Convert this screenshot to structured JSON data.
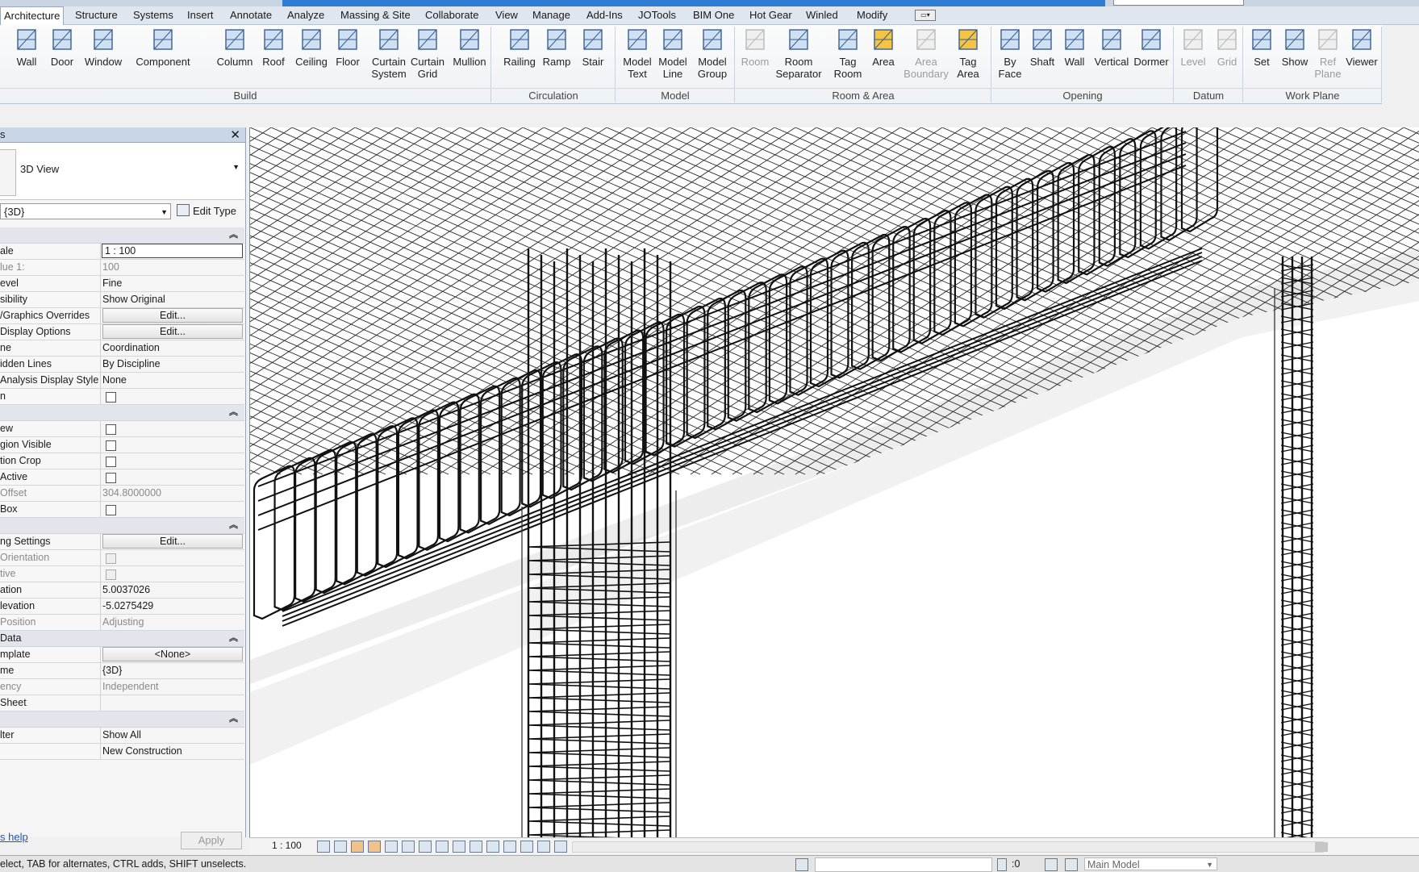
{
  "ribbon_tabs": [
    "Architecture",
    "Structure",
    "Systems",
    "Insert",
    "Annotate",
    "Analyze",
    "Massing & Site",
    "Collaborate",
    "View",
    "Manage",
    "Add-Ins",
    "JOTools",
    "BIM One",
    "Hot Gear",
    "Winled",
    "Modify"
  ],
  "ribbon": {
    "build": {
      "title": "Build",
      "buttons": [
        {
          "label": "Wall",
          "icon": "wall-icon"
        },
        {
          "label": "Door",
          "icon": "door-icon"
        },
        {
          "label": "Window",
          "icon": "window-icon"
        },
        {
          "label": "Component",
          "icon": "component-icon"
        },
        {
          "label": "Column",
          "icon": "column-icon"
        },
        {
          "label": "Roof",
          "icon": "roof-icon"
        },
        {
          "label": "Ceiling",
          "icon": "ceiling-icon"
        },
        {
          "label": "Floor",
          "icon": "floor-icon"
        },
        {
          "label": "Curtain",
          "label2": "System",
          "icon": "curtain-system-icon"
        },
        {
          "label": "Curtain",
          "label2": "Grid",
          "icon": "curtain-grid-icon"
        },
        {
          "label": "Mullion",
          "icon": "mullion-icon"
        }
      ]
    },
    "circulation": {
      "title": "Circulation",
      "buttons": [
        {
          "label": "Railing",
          "icon": "railing-icon"
        },
        {
          "label": "Ramp",
          "icon": "ramp-icon"
        },
        {
          "label": "Stair",
          "icon": "stair-icon"
        }
      ]
    },
    "model": {
      "title": "Model",
      "buttons": [
        {
          "label": "Model",
          "label2": "Text",
          "icon": "model-text-icon"
        },
        {
          "label": "Model",
          "label2": "Line",
          "icon": "model-line-icon"
        },
        {
          "label": "Model",
          "label2": "Group",
          "icon": "model-group-icon"
        }
      ]
    },
    "room_area": {
      "title": "Room & Area",
      "buttons": [
        {
          "label": "Room",
          "icon": "room-icon",
          "disabled": true
        },
        {
          "label": "Room",
          "label2": "Separator",
          "icon": "room-separator-icon"
        },
        {
          "label": "Tag",
          "label2": "Room",
          "icon": "tag-room-icon"
        },
        {
          "label": "Area",
          "icon": "area-icon"
        },
        {
          "label": "Area",
          "label2": "Boundary",
          "icon": "area-boundary-icon",
          "disabled": true
        },
        {
          "label": "Tag",
          "label2": "Area",
          "icon": "tag-area-icon"
        }
      ]
    },
    "opening": {
      "title": "Opening",
      "buttons": [
        {
          "label": "By",
          "label2": "Face",
          "icon": "by-face-icon"
        },
        {
          "label": "Shaft",
          "icon": "shaft-icon"
        },
        {
          "label": "Wall",
          "icon": "wall-opening-icon"
        },
        {
          "label": "Vertical",
          "icon": "vertical-icon"
        },
        {
          "label": "Dormer",
          "icon": "dormer-icon"
        }
      ]
    },
    "datum": {
      "title": "Datum",
      "buttons": [
        {
          "label": "Level",
          "icon": "level-icon",
          "disabled": true
        },
        {
          "label": "Grid",
          "icon": "grid-icon",
          "disabled": true
        }
      ]
    },
    "work_plane": {
      "title": "Work Plane",
      "buttons": [
        {
          "label": "Set",
          "icon": "set-icon"
        },
        {
          "label": "Show",
          "icon": "show-icon"
        },
        {
          "label": "Ref",
          "label2": "Plane",
          "icon": "ref-plane-icon",
          "disabled": true
        },
        {
          "label": "Viewer",
          "icon": "viewer-icon"
        }
      ]
    }
  },
  "properties": {
    "header": "s",
    "type_name": "3D View",
    "view_selector": "{3D}",
    "edit_type": "Edit Type",
    "rows": [
      {
        "kind": "section"
      },
      {
        "k": "ale",
        "v": "1 : 100",
        "style": "input"
      },
      {
        "k": "lue   1:",
        "v": "100",
        "gray": true
      },
      {
        "k": "evel",
        "v": "Fine"
      },
      {
        "k": "sibility",
        "v": "Show Original"
      },
      {
        "k": "/Graphics Overrides",
        "v": "Edit...",
        "style": "btn"
      },
      {
        "k": " Display Options",
        "v": "Edit...",
        "style": "btn"
      },
      {
        "k": "ne",
        "v": "Coordination"
      },
      {
        "k": "idden Lines",
        "v": "By Discipline"
      },
      {
        "k": "Analysis Display Style",
        "v": "None"
      },
      {
        "k": "n",
        "check": true
      },
      {
        "kind": "section"
      },
      {
        "k": "ew",
        "check": true
      },
      {
        "k": "gion Visible",
        "check": true
      },
      {
        "k": "tion Crop",
        "check": true
      },
      {
        "k": " Active",
        "check": true
      },
      {
        "k": " Offset",
        "v": "304.8000000",
        "gray": true
      },
      {
        "k": " Box",
        "check": true
      },
      {
        "kind": "section"
      },
      {
        "k": "ng Settings",
        "v": "Edit...",
        "style": "btn"
      },
      {
        "k": " Orientation",
        "check": true,
        "gray": true
      },
      {
        "k": "tive",
        "check": true,
        "gray": true
      },
      {
        "k": "ation",
        "v": "5.0037026"
      },
      {
        "k": "levation",
        "v": "-5.0275429"
      },
      {
        "k": " Position",
        "v": "Adjusting",
        "gray": true
      },
      {
        "kind": "section",
        "label": "Data"
      },
      {
        "k": "mplate",
        "v": "<None>",
        "style": "btn"
      },
      {
        "k": "me",
        "v": "{3D}"
      },
      {
        "k": "ency",
        "v": "Independent",
        "gray": true
      },
      {
        "k": " Sheet",
        "v": ""
      },
      {
        "kind": "section"
      },
      {
        "k": "lter",
        "v": "Show All"
      },
      {
        "k": "",
        "v": "New Construction"
      }
    ],
    "help_link": "s help",
    "apply": "Apply"
  },
  "view_control": {
    "scale": "1 : 100"
  },
  "status": {
    "message": "elect, TAB for alternates, CTRL adds, SHIFT unselects.",
    "selection_count": ":0",
    "model": "Main Model"
  },
  "colors": {
    "ribbon_active_tab": "#ffffff",
    "title_blue": "#2e7bd3",
    "panel_header": "#c9d6e8",
    "link": "#1a57c5"
  }
}
